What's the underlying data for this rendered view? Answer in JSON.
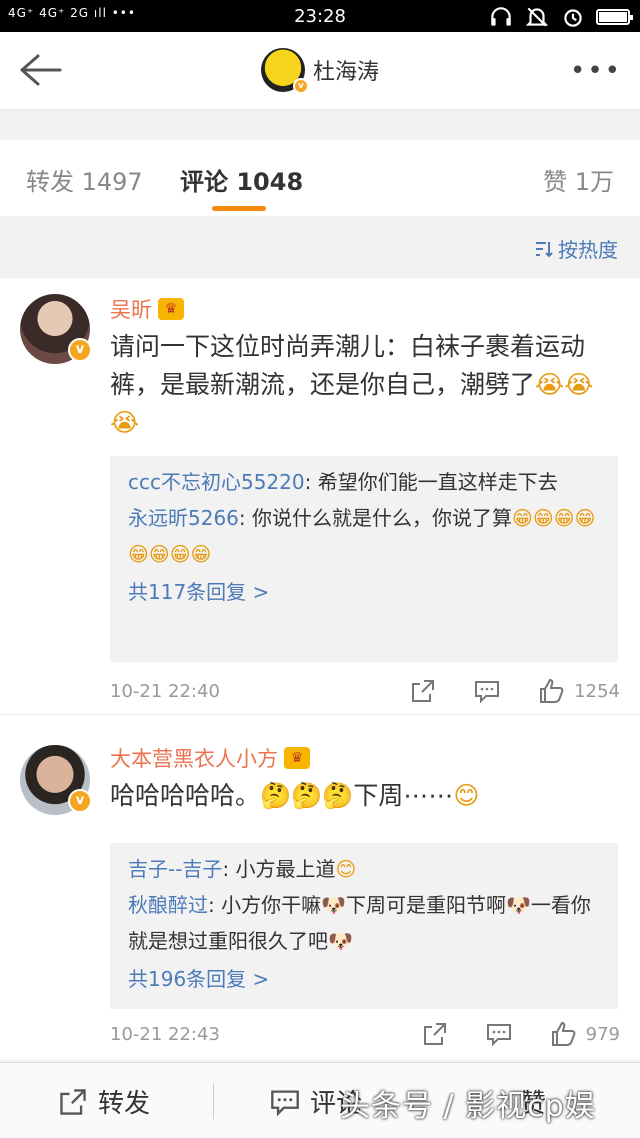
{
  "status_bar": {
    "signal": "4G⁺ 4G⁺ 2G ıll •••",
    "time": "23:28"
  },
  "header": {
    "title": "杜海涛"
  },
  "tabs": [
    {
      "label": "转发 1497",
      "active": false
    },
    {
      "label": "评论 1048",
      "active": true
    },
    {
      "label": "赞 1万",
      "active": false
    }
  ],
  "sort": {
    "label": "按热度"
  },
  "comments": [
    {
      "user": "吴昕",
      "text": "请问一下这位时尚弄潮儿：白袜子裹着运动裤，是最新潮流，还是你自己，潮劈了",
      "emoji": "😭😭😭",
      "replies": [
        {
          "user": "ccc不忘初心55220",
          "text": "希望你们能一直这样走下去"
        },
        {
          "user": "永远昕5266",
          "text": "你说什么就是什么，你说了算",
          "emoji": "😁😁😁😁😁😁😁😁"
        }
      ],
      "more_replies": "共117条回复 >",
      "time": "10-21 22:40",
      "likes": "1254"
    },
    {
      "user": "大本营黑衣人小方",
      "text": "哈哈哈哈哈。",
      "emoji_mid": "🤔🤔🤔",
      "text2": "下周⋯⋯",
      "emoji_end": "😊",
      "replies": [
        {
          "user": "吉子--吉子",
          "text": "小方最上道",
          "emoji": "😊"
        },
        {
          "user": "秋酿醉过",
          "text": "小方你干嘛🐶下周可是重阳节啊🐶一看你就是想过重阳很久了吧🐶"
        }
      ],
      "more_replies": "共196条回复 >",
      "time": "10-21 22:43",
      "likes": "979"
    }
  ],
  "bottom_bar": {
    "repost": "转发",
    "comment": "评论",
    "like": "赞"
  },
  "watermark": "头条号 / 影视cp娱"
}
